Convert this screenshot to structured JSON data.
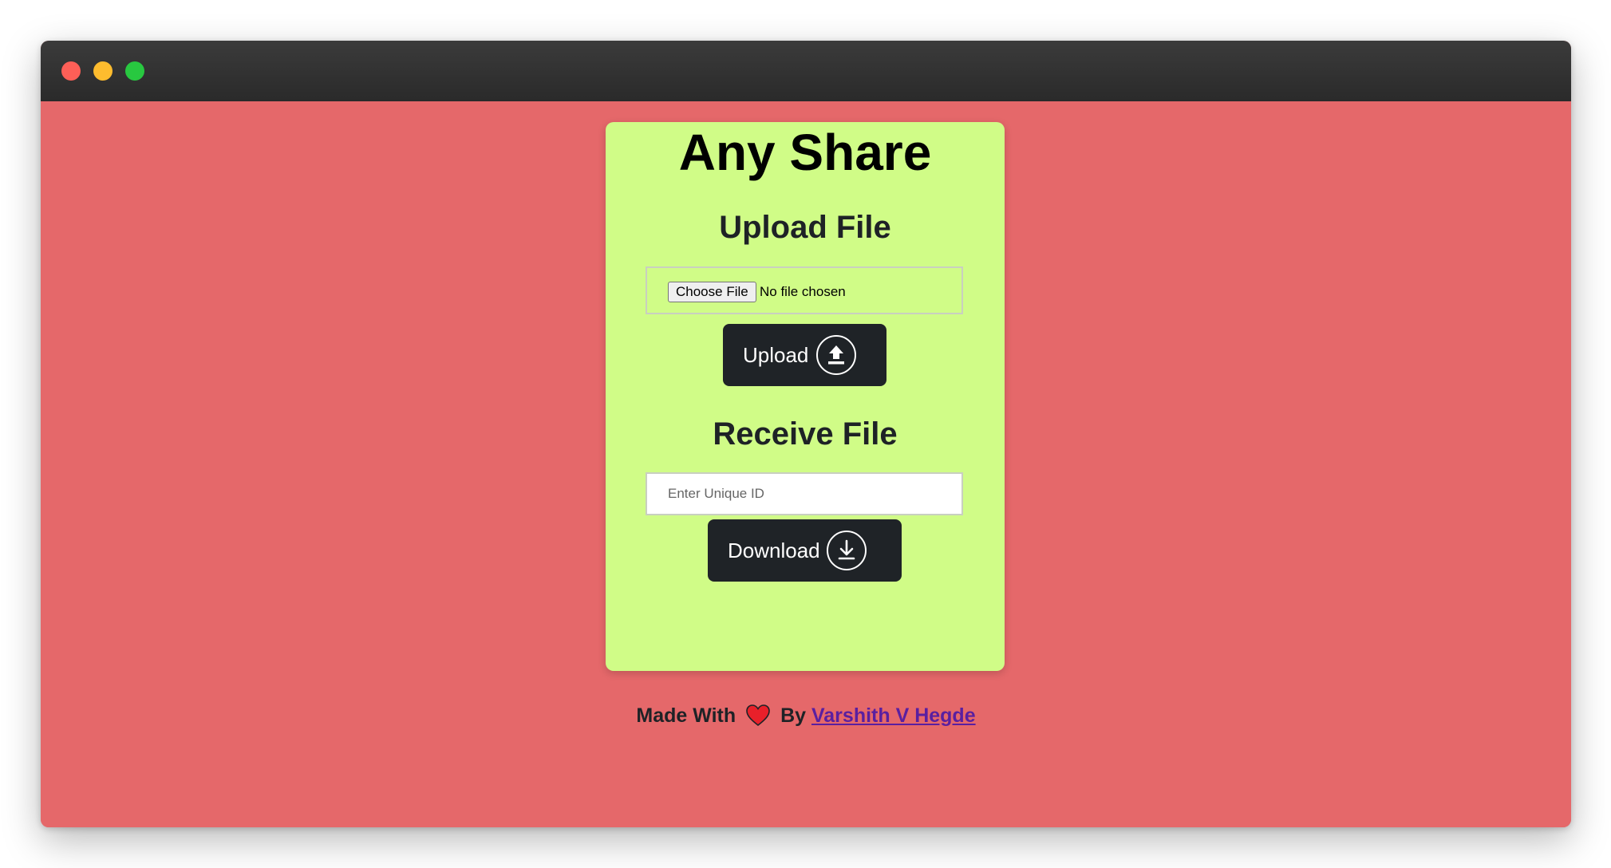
{
  "app": {
    "title": "Any Share"
  },
  "upload": {
    "heading": "Upload File",
    "choose_label": "Choose File",
    "file_status": "No file chosen",
    "button_label": "Upload",
    "icon": "upload-circle-icon"
  },
  "receive": {
    "heading": "Receive File",
    "id_placeholder": "Enter Unique ID",
    "id_value": "",
    "button_label": "Download",
    "icon": "download-circle-icon"
  },
  "footer": {
    "made_with": "Made With",
    "heart_icon": "heart-icon",
    "by": "By",
    "author": "Varshith V Hegde"
  },
  "colors": {
    "page_background": "#e5686a",
    "card_background": "#d0fc87",
    "button_background": "#1f2327",
    "heart": "#e8202a",
    "link": "#5a1fa0"
  }
}
